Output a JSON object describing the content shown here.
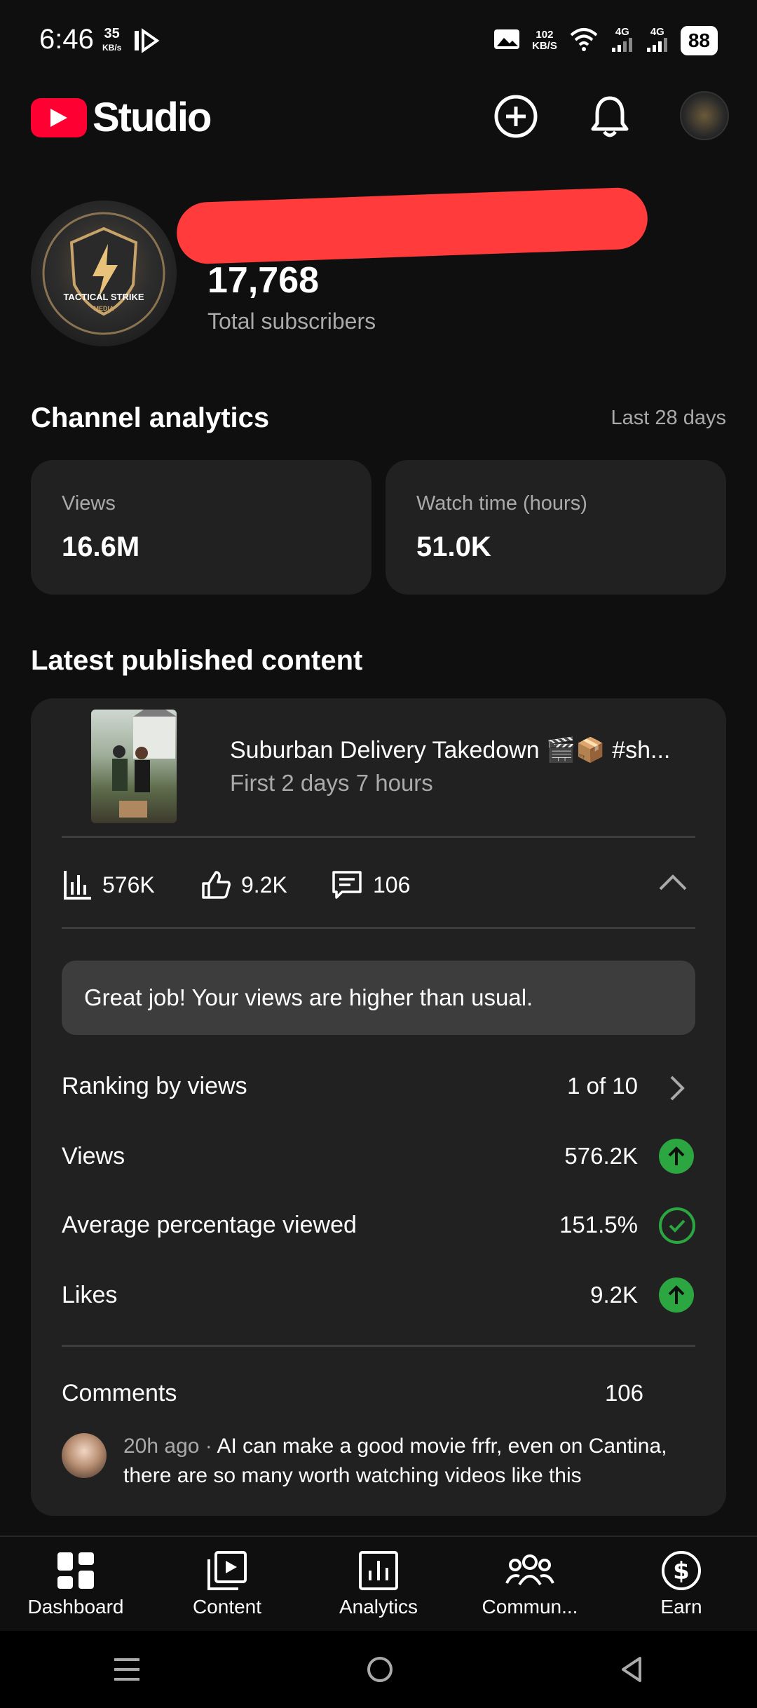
{
  "status_bar": {
    "time": "6:46",
    "data_speed": "35",
    "data_speed_unit": "KB/s",
    "net_speed": "102",
    "net_speed_unit": "KB/S",
    "network_1": "4G",
    "network_2": "4G",
    "battery": "88"
  },
  "header": {
    "app_name": "Studio",
    "create_icon": "plus-circle-icon",
    "notifications_icon": "bell-icon",
    "avatar_icon": "channel-avatar"
  },
  "channel": {
    "logo_text_line1": "TACTICAL STRIKE",
    "logo_text_line2": "MEDIA",
    "subscriber_count": "17,768",
    "subscriber_label": "Total subscribers"
  },
  "analytics": {
    "title": "Channel analytics",
    "period": "Last 28 days",
    "cards": [
      {
        "label": "Views",
        "value": "16.6M"
      },
      {
        "label": "Watch time (hours)",
        "value": "51.0K"
      }
    ]
  },
  "latest": {
    "title": "Latest published content",
    "video_title": "Suburban Delivery Takedown 🎬📦 #sh...",
    "video_subtitle": "First 2 days 7 hours",
    "metrics": {
      "views": "576K",
      "likes": "9.2K",
      "comments": "106"
    },
    "notice": "Great job! Your views are higher than usual.",
    "rows": [
      {
        "label": "Ranking by views",
        "value": "1 of 10",
        "icon": "chevron-right-icon"
      },
      {
        "label": "Views",
        "value": "576.2K",
        "icon": "arrow-up-icon"
      },
      {
        "label": "Average percentage viewed",
        "value": "151.5%",
        "icon": "check-circle-icon"
      },
      {
        "label": "Likes",
        "value": "9.2K",
        "icon": "arrow-up-icon"
      }
    ],
    "comments_label": "Comments",
    "comments_count": "106",
    "comment": {
      "meta": "20h ago · ",
      "text": "AI can make a good movie frfr, even on Cantina, there are so many worth watching videos like this"
    }
  },
  "bottom_nav": [
    {
      "label": "Dashboard",
      "icon": "dashboard-icon"
    },
    {
      "label": "Content",
      "icon": "content-icon"
    },
    {
      "label": "Analytics",
      "icon": "analytics-icon"
    },
    {
      "label": "Commun...",
      "icon": "community-icon"
    },
    {
      "label": "Earn",
      "icon": "earn-icon"
    }
  ],
  "colors": {
    "background": "#0f0f0f",
    "card": "#212121",
    "brand_red": "#ff0033",
    "success_green": "#2ba640",
    "muted_text": "#aaaaaa"
  }
}
